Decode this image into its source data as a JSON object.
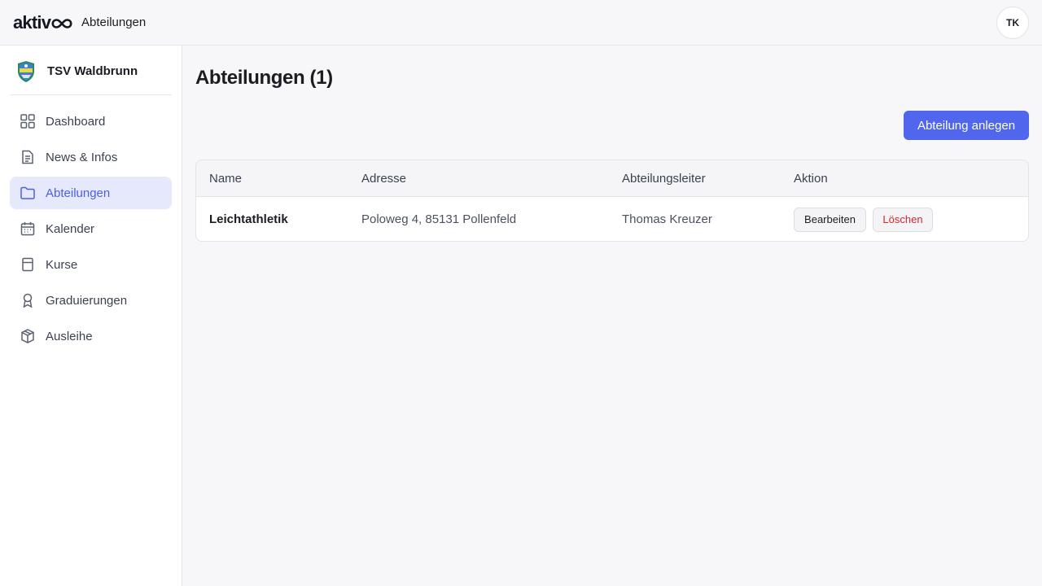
{
  "app": {
    "logo_text": "aktiv",
    "section_title": "Abteilungen",
    "user_initials": "TK"
  },
  "club": {
    "name": "TSV Waldbrunn"
  },
  "sidebar": {
    "items": [
      {
        "label": "Dashboard",
        "icon": "grid-icon",
        "active": false
      },
      {
        "label": "News & Infos",
        "icon": "document-icon",
        "active": false
      },
      {
        "label": "Abteilungen",
        "icon": "folder-icon",
        "active": true
      },
      {
        "label": "Kalender",
        "icon": "calendar-icon",
        "active": false
      },
      {
        "label": "Kurse",
        "icon": "book-icon",
        "active": false
      },
      {
        "label": "Graduierungen",
        "icon": "award-icon",
        "active": false
      },
      {
        "label": "Ausleihe",
        "icon": "package-icon",
        "active": false
      }
    ]
  },
  "main": {
    "title": "Abteilungen (1)",
    "create_button": "Abteilung anlegen",
    "table": {
      "columns": [
        "Name",
        "Adresse",
        "Abteilungsleiter",
        "Aktion"
      ],
      "rows": [
        {
          "name": "Leichtathletik",
          "address": "Poloweg 4, 85131 Pollenfeld",
          "leader": "Thomas Kreuzer",
          "edit_label": "Bearbeiten",
          "delete_label": "Löschen"
        }
      ]
    }
  },
  "colors": {
    "accent": "#4f66ed",
    "active_bg": "#e6e9fc",
    "danger": "#d9262b"
  }
}
